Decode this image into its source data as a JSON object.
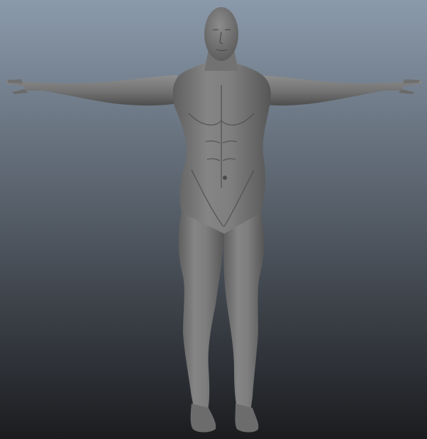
{
  "viewport": {
    "background_top": "#8b9aab",
    "background_bottom": "#1b1c1f",
    "model_color": "#7b7b7b",
    "model_shadow": "#2e2e2e",
    "model_highlight": "#a2a2a2",
    "model_name": "t-pose-male-mannequin"
  }
}
